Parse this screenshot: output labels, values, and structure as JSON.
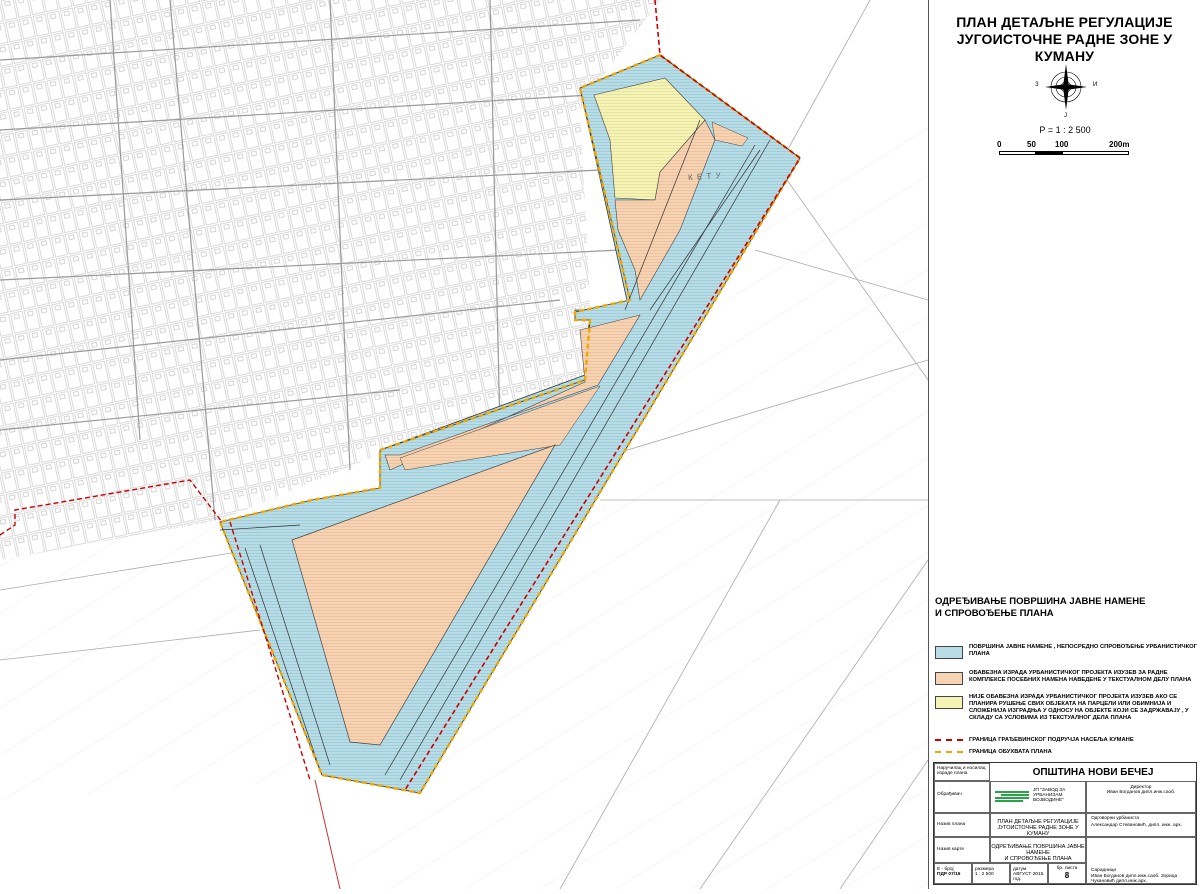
{
  "header": {
    "title_line1": "ПЛАН ДЕТАЉНЕ РЕГУЛАЦИЈЕ",
    "title_line2": "ЈУГОИСТОЧНЕ РАДНЕ ЗОНЕ У КУМАНУ"
  },
  "north_arrow": {
    "w": "З",
    "e": "И",
    "s": "Ј"
  },
  "scale": {
    "ratio": "Р = 1 : 2 500",
    "ticks": [
      "0",
      "50",
      "100",
      "200m"
    ]
  },
  "map": {
    "area_label": "К Е Т У"
  },
  "legend": {
    "title_line1": "ОДРЕЂИВАЊЕ ПОВРШИНА ЈАВНЕ НАМЕНЕ",
    "title_line2": "И СПРОВОЂЕЊЕ ПЛАНА",
    "items": [
      {
        "text": "ПОВРШИНА ЈАВНЕ НАМЕНЕ , НЕПОСРЕДНО СПРОВОЂЕЊЕ УРБАНИСТИЧКОГ ПЛАНА",
        "color": "#b8dde6"
      },
      {
        "text": "ОБАВЕЗНА ИЗРАДА УРБАНИСТИЧКОГ ПРОЈЕКТА ИЗУЗЕВ ЗА РАДНЕ КОМПЛЕКСЕ ПОСЕБНИХ НАМЕНА НАВЕДЕНЕ У ТЕКСТУАЛНОМ ДЕЛУ ПЛАНА",
        "color": "#f6d3b3"
      },
      {
        "text": "НИЈЕ ОБАВЕЗНА ИЗРАДА УРБАНИСТИЧКОГ ПРОЈЕКТА ИЗУЗЕВ АКО СЕ ПЛАНИРА РУШЕЊЕ СВИХ ОБЈЕКАТА НА ПАРЦЕЛИ ИЛИ ОБИМНИЈА И СЛОЖЕНИЈА ИЗГРАДЊА У ОДНОСУ НА ОБЈЕКТЕ КОЈИ СЕ ЗАДРЖАВАЈУ , У СКЛАДУ СА УСЛОВИМА ИЗ ТЕКСТУАЛНОГ ДЕЛА ПЛАНА",
        "color": "#f5f3b5"
      }
    ],
    "lines": [
      {
        "text": "ГРАНИЦА ГРАЂЕВИНСКОГ ПОДРУЧЈА НАСЕЉА КУМАНЕ",
        "color": "#cc0000"
      },
      {
        "text": "ГРАНИЦА ОБУХВАТА ПЛАНА",
        "color": "#f0a800"
      }
    ]
  },
  "titleblock": {
    "municipality": "ОПШТИНА НОВИ БЕЧЕЈ",
    "label_client": "Наручилац и носилац израде плана",
    "label_maker": "Обрађивач",
    "maker_text": "ЈП \"ЗАВОД ЗА УРБАНИЗАМ ВОЈВОДИНЕ\"",
    "director_label": "Директор",
    "director_name": "Иван Богданов дипл.инж.саоб.",
    "label_plan": "Назив плана",
    "plan_name_1": "ПЛАН ДЕТАЉНЕ РЕГУЛАЦИЈЕ",
    "plan_name_2": "ЈУГОИСТОЧНЕ РАДНЕ ЗОНЕ У КУМАНУ",
    "responsible_label": "Одговорни урбаниста",
    "responsible_name": "Александар Стевановић, дипл. инж. арх.",
    "label_map": "Назив карте",
    "map_name_1": "ОДРЕЂИВАЊЕ ПОВРШИНА ЈАВНЕ НАМЕНЕ",
    "map_name_2": "И СПРОВОЂЕЊЕ ПЛАНА",
    "label_num": "Е - број",
    "num_value": "ПДР 07/16",
    "label_scale": "размера",
    "scale_value": "1 : 2 500",
    "label_date": "датум",
    "date_value": "АВГУСТ 2015. год.",
    "label_sheet": "бр. листа",
    "sheet_value": "8",
    "collab_label": "Сарадници",
    "collab_names": "Иван Богданов дипл.инж.саоб. Зорица Чукановић дипл.инж.арх."
  }
}
